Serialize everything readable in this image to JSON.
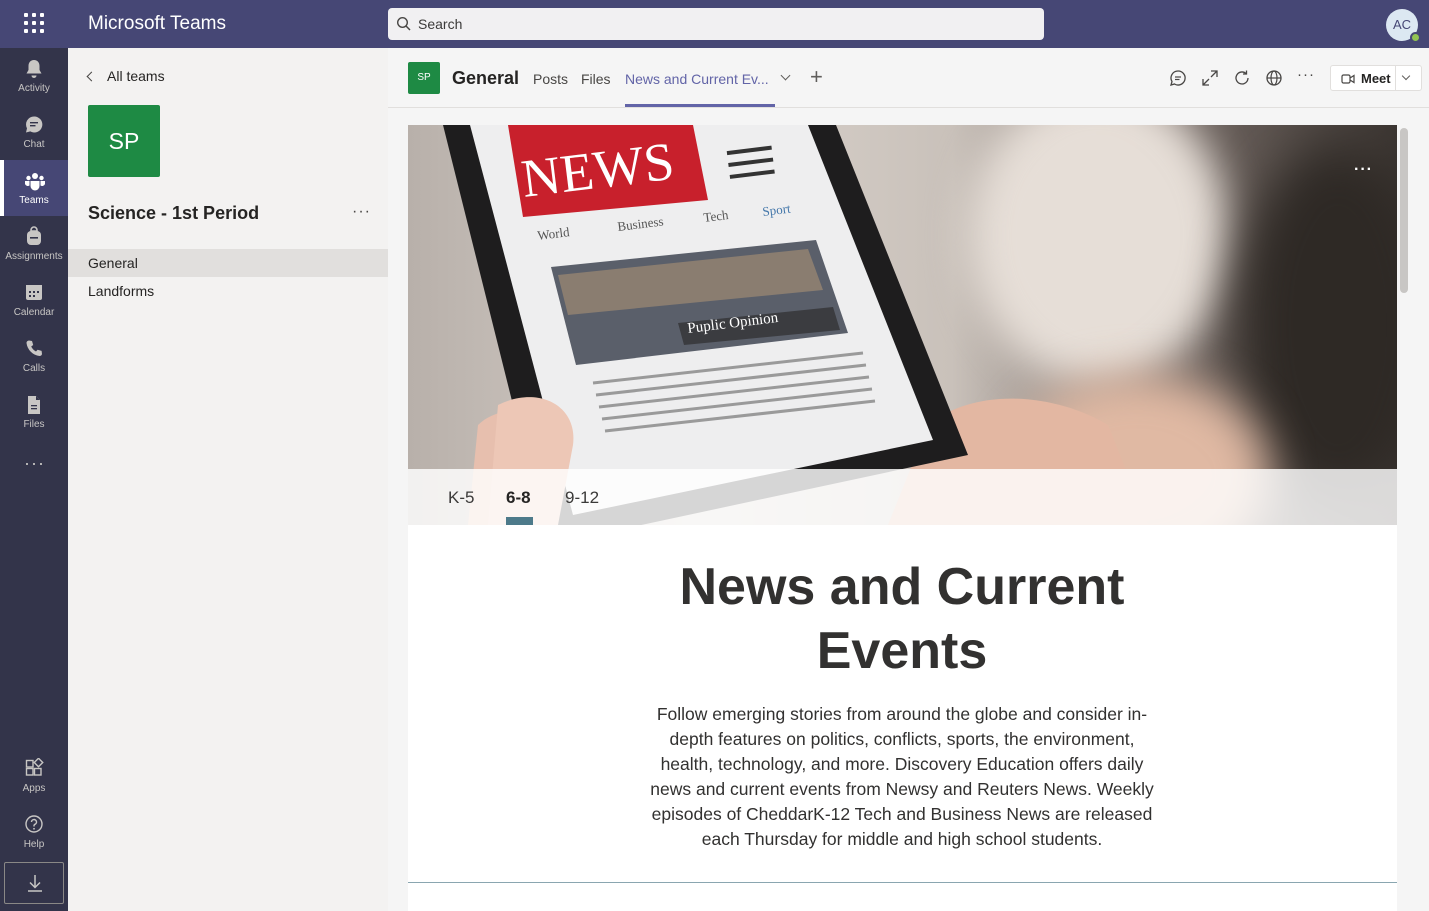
{
  "app": {
    "title": "Microsoft Teams"
  },
  "search": {
    "placeholder": "Search"
  },
  "user": {
    "initials": "AC"
  },
  "rail": {
    "items": [
      {
        "label": "Activity",
        "icon": "bell-icon"
      },
      {
        "label": "Chat",
        "icon": "chat-icon"
      },
      {
        "label": "Teams",
        "icon": "teams-icon"
      },
      {
        "label": "Assignments",
        "icon": "backpack-icon"
      },
      {
        "label": "Calendar",
        "icon": "calendar-icon"
      },
      {
        "label": "Calls",
        "icon": "phone-icon"
      },
      {
        "label": "Files",
        "icon": "file-icon"
      }
    ],
    "more": "···",
    "apps_label": "Apps",
    "help_label": "Help"
  },
  "panel": {
    "back_label": "All teams",
    "team_initials": "SP",
    "team_name": "Science - 1st Period",
    "more": "···",
    "channels": [
      "General",
      "Landforms"
    ]
  },
  "channel_header": {
    "icon_initials": "SP",
    "name": "General",
    "tabs": [
      "Posts",
      "Files",
      "News and Current Ev..."
    ],
    "add_tab": "+",
    "more": "···",
    "meet_label": "Meet"
  },
  "content": {
    "hero_more": "···",
    "grades": [
      "K-5",
      "6-8",
      "9-12"
    ],
    "selected_grade": "6-8",
    "headline": "News and Current Events",
    "description": "Follow emerging stories from around the globe and consider in-depth features on politics, conflicts, sports, the environment, health, technology, and more. Discovery Education offers daily news and current events from Newsy and Reuters News. Weekly episodes of CheddarK-12 Tech and Business News are released each Thursday for middle and high school students.",
    "phone_screen": {
      "masthead": "NEWS",
      "sections": [
        "World",
        "Business",
        "Tech",
        "Sport"
      ],
      "caption": "Puplic Opinion"
    }
  },
  "colors": {
    "topbar": "#464775",
    "rail": "#33344a",
    "accent": "#6264a7",
    "team_tile": "#1e8a44",
    "grade_underline": "#4d7a8a"
  }
}
